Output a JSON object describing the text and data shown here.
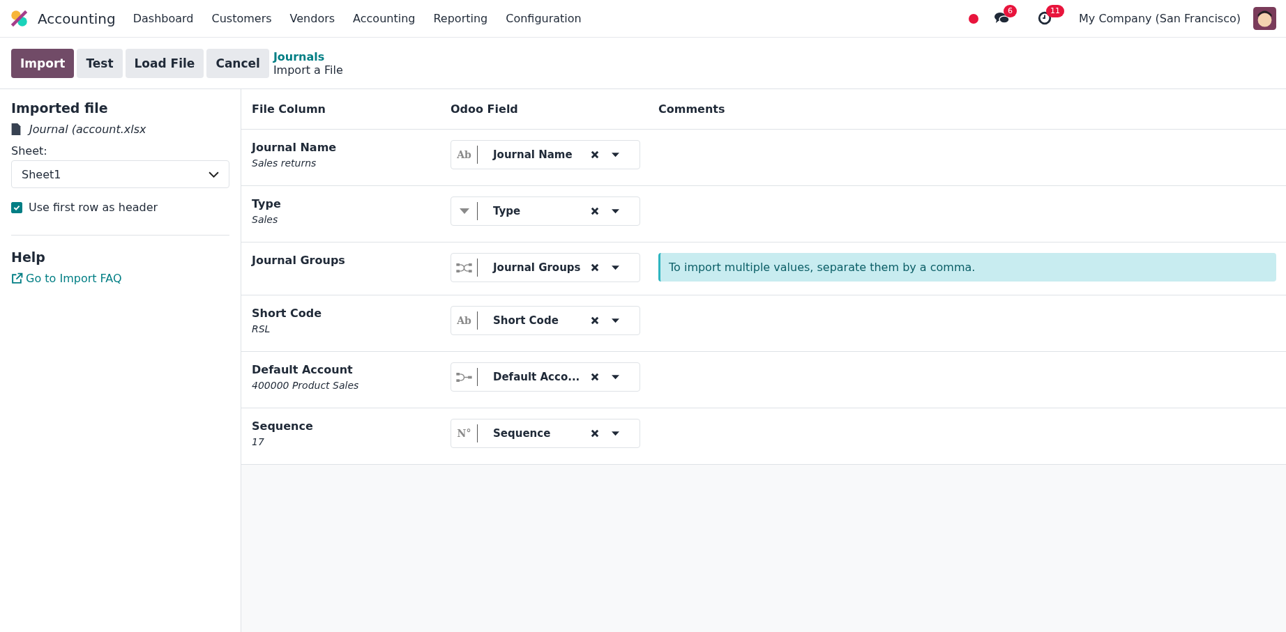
{
  "navbar": {
    "app_name": "Accounting",
    "menu": [
      "Dashboard",
      "Customers",
      "Vendors",
      "Accounting",
      "Reporting",
      "Configuration"
    ],
    "messages_count": "6",
    "activities_count": "11",
    "company": "My Company (San Francisco)"
  },
  "control_panel": {
    "buttons": [
      {
        "label": "Import",
        "kind": "primary"
      },
      {
        "label": "Test",
        "kind": "secondary"
      },
      {
        "label": "Load File",
        "kind": "secondary"
      },
      {
        "label": "Cancel",
        "kind": "secondary"
      }
    ],
    "breadcrumb": "Journals",
    "title": "Import a File"
  },
  "sidebar": {
    "imported_file_title": "Imported file",
    "file_name": "Journal (account.xlsx",
    "sheet_label": "Sheet:",
    "sheet_value": "Sheet1",
    "header_option": {
      "label": "Use first row as header",
      "checked": true
    },
    "help_title": "Help",
    "faq_link": "Go to Import FAQ"
  },
  "table": {
    "columns": [
      "File Column",
      "Odoo Field",
      "Comments"
    ],
    "rows": [
      {
        "column": "Journal Name",
        "sample": "Sales returns",
        "kind": "text",
        "field_icon": "Ab",
        "field": "Journal Name"
      },
      {
        "column": "Type",
        "sample": "Sales",
        "kind": "selection",
        "field": "Type"
      },
      {
        "column": "Journal Groups",
        "kind": "many2many",
        "field": "Journal Groups",
        "comment": "To import multiple values, separate them by a comma."
      },
      {
        "column": "Short Code",
        "sample": "RSL",
        "kind": "text",
        "field_icon": "Ab",
        "field": "Short Code"
      },
      {
        "column": "Default Account",
        "sample": "400000 Product Sales",
        "kind": "many2one",
        "field": "Default Acco..."
      },
      {
        "column": "Sequence",
        "sample": "17",
        "kind": "text",
        "field_icon": "N°",
        "field": "Sequence"
      }
    ]
  }
}
